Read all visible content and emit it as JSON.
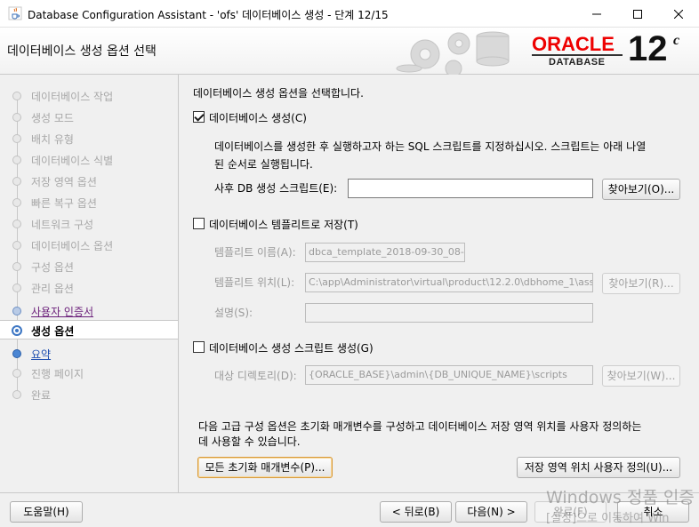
{
  "window": {
    "title": "Database Configuration Assistant - 'ofs' 데이터베이스 생성 - 단계 12/15",
    "icons": {
      "app": "java-cup-icon",
      "minimize": "minimize-icon",
      "maximize": "maximize-icon",
      "close": "close-icon"
    }
  },
  "header": {
    "page_title": "데이터베이스 생성 옵션 선택",
    "brand_word": "ORACLE",
    "brand_sub": "DATABASE",
    "version": "12",
    "version_suffix": "c",
    "brand_color": "#e00000"
  },
  "steps": [
    {
      "label": "데이터베이스 작업",
      "state": "disabled"
    },
    {
      "label": "생성 모드",
      "state": "disabled"
    },
    {
      "label": "배치 유형",
      "state": "disabled"
    },
    {
      "label": "데이터베이스 식별",
      "state": "disabled"
    },
    {
      "label": "저장 영역 옵션",
      "state": "disabled"
    },
    {
      "label": "빠른 복구 옵션",
      "state": "disabled"
    },
    {
      "label": "네트워크 구성",
      "state": "disabled"
    },
    {
      "label": "데이터베이스 옵션",
      "state": "disabled"
    },
    {
      "label": "구성 옵션",
      "state": "disabled"
    },
    {
      "label": "관리 옵션",
      "state": "disabled"
    },
    {
      "label": "사용자 인증서",
      "state": "link"
    },
    {
      "label": "생성 옵션",
      "state": "current"
    },
    {
      "label": "요약",
      "state": "next"
    },
    {
      "label": "진행 페이지",
      "state": "disabled"
    },
    {
      "label": "완료",
      "state": "disabled"
    }
  ],
  "content": {
    "intro": "데이터베이스 생성 옵션을 선택합니다.",
    "create_db": {
      "label": "데이터베이스 생성(C)",
      "checked": true,
      "desc_line1": "데이터베이스를 생성한 후 실행하고자 하는 SQL 스크립트를 지정하십시오. 스크립트는 아래 나열",
      "desc_line2": "된 순서로 실행됩니다.",
      "post_script_label": "사후 DB 생성 스크립트(E):",
      "post_script_value": "",
      "browse_label": "찾아보기(O)..."
    },
    "save_template": {
      "label": "데이터베이스 템플리트로 저장(T)",
      "checked": false,
      "name_label": "템플리트 이름(A):",
      "name_value": "dbca_template_2018-09-30_08-",
      "location_label": "템플리트 위치(L):",
      "location_value": "C:\\app\\Administrator\\virtual\\product\\12.2.0\\dbhome_1\\assis",
      "location_browse": "찾아보기(R)...",
      "desc_label": "설명(S):",
      "desc_value": ""
    },
    "gen_scripts": {
      "label": "데이터베이스 생성 스크립트 생성(G)",
      "checked": false,
      "dir_label": "대상 디렉토리(D):",
      "dir_value": "{ORACLE_BASE}\\admin\\{DB_UNIQUE_NAME}\\scripts",
      "dir_browse": "찾아보기(W)..."
    },
    "advanced_line1": "다음 고급 구성 옵션은 초기화 매개변수를 구성하고 데이터베이스 저장 영역 위치를 사용자 정의하는",
    "advanced_line2": "데 사용할 수 있습니다.",
    "all_params_button": "모든 초기화 매개변수(P)...",
    "storage_button": "저장 영역 위치 사용자 정의(U)..."
  },
  "footer": {
    "help": "도움말(H)",
    "back": "< 뒤로(B)",
    "next": "다음(N) >",
    "finish": "완료(F)",
    "cancel": "취소"
  },
  "watermark": {
    "line1": "Windows 정품 인증",
    "line2": "[설정]으로 이동하여 Win"
  }
}
